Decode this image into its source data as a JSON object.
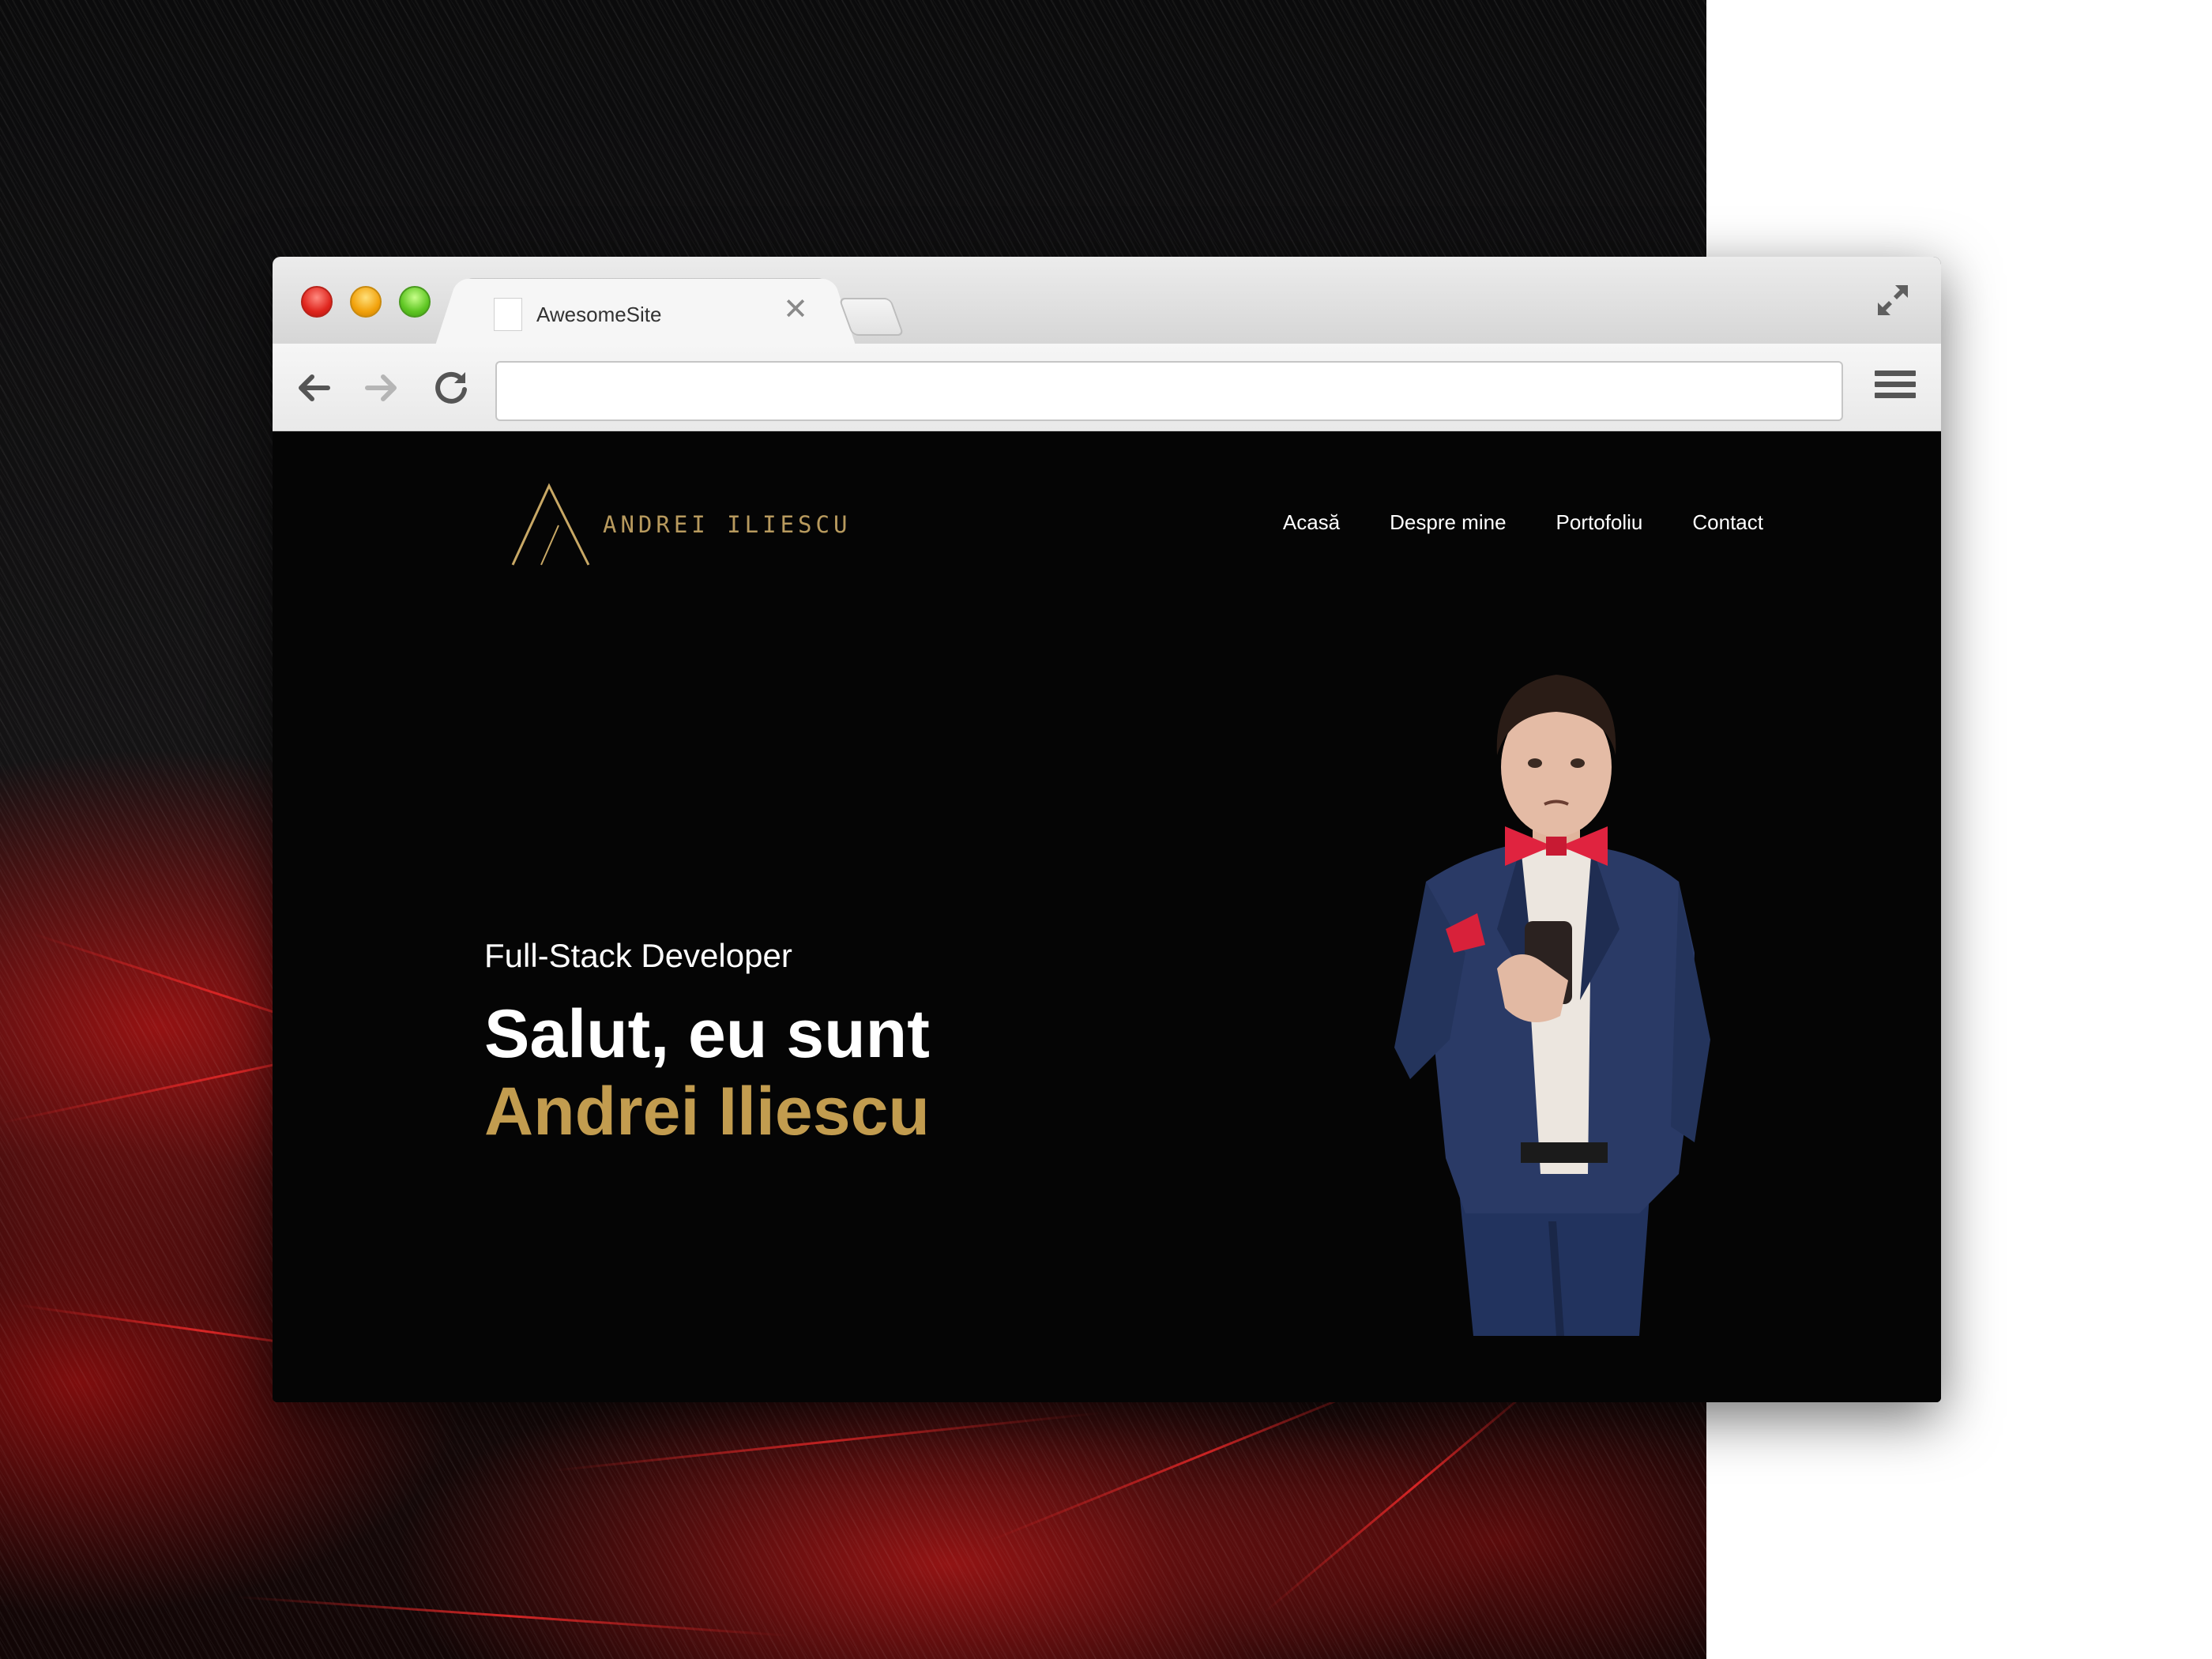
{
  "browser": {
    "tab_title": "AwesomeSite",
    "tab_close": "✕",
    "address_value": "",
    "icons": [
      "close-dot",
      "minimize-dot",
      "zoom-dot",
      "fullscreen-icon",
      "back-arrow-icon",
      "forward-arrow-icon",
      "reload-icon",
      "hamburger-menu-icon"
    ]
  },
  "site": {
    "logo_letter": "A",
    "logo_text": "ANDREI ILIESCU",
    "nav": [
      "Acasă",
      "Despre mine",
      "Portofoliu",
      "Contact"
    ],
    "subtitle": "Full-Stack Developer",
    "headline_line1": "Salut, eu sunt",
    "headline_line2": "Andrei Iliescu",
    "portrait_alt": "portrait-photo"
  },
  "colors": {
    "page_bg": "#050505",
    "accent_gold": "#c29c4f",
    "logo_gold": "#b89a5e",
    "text_white": "#ffffff",
    "backdrop_red": "#c01818"
  }
}
